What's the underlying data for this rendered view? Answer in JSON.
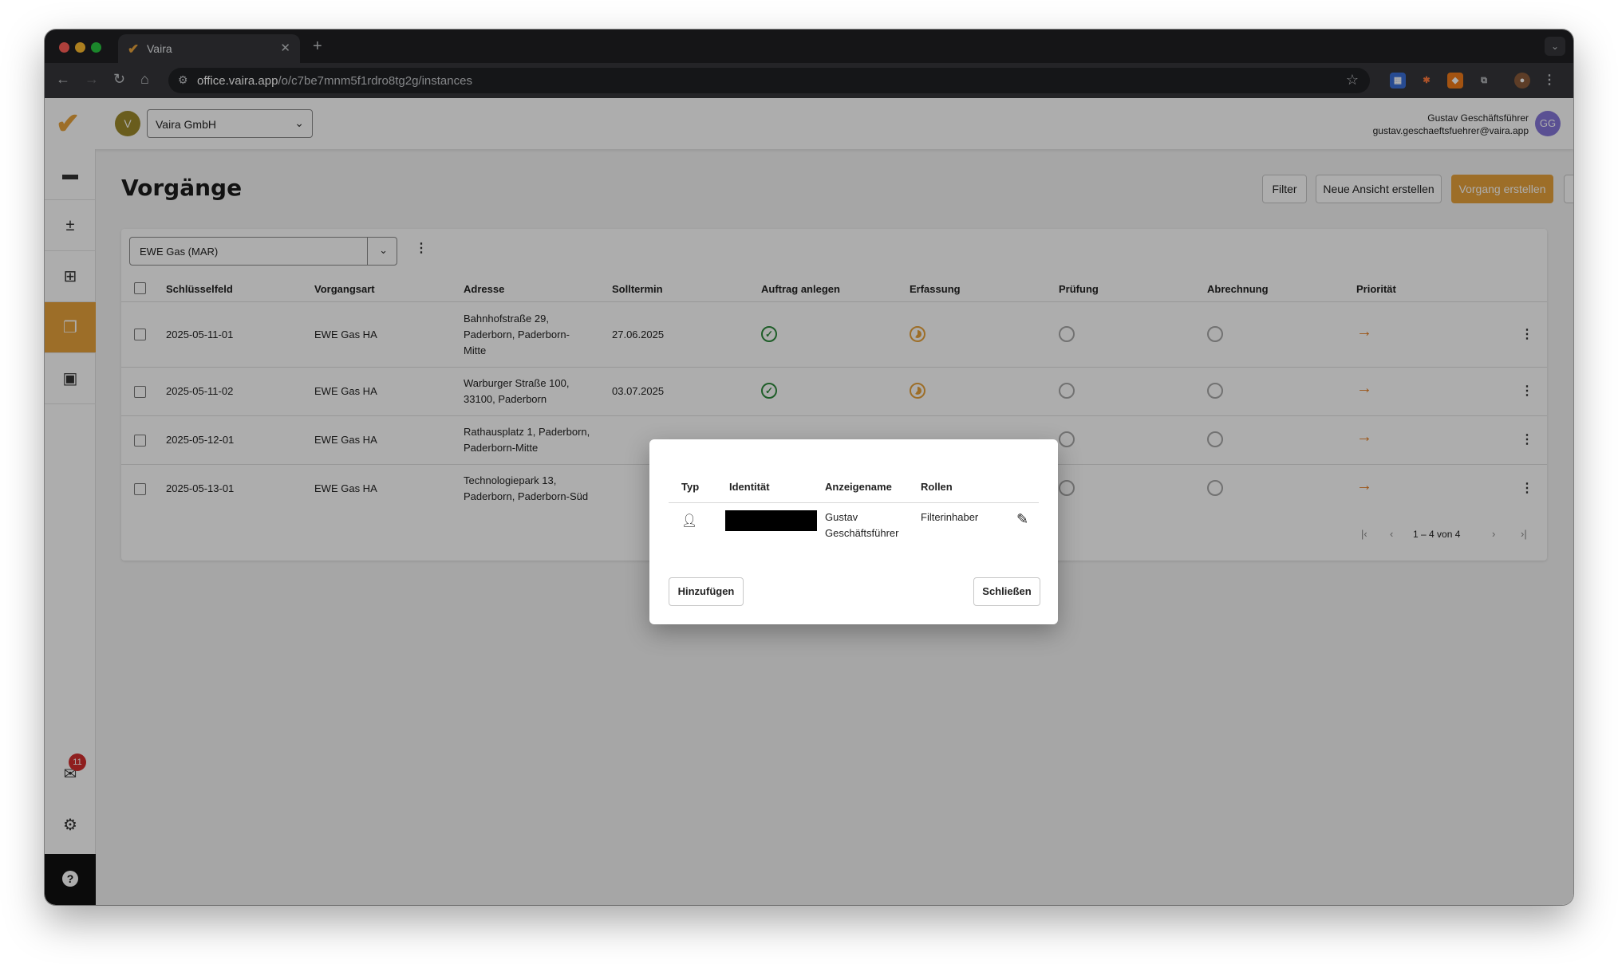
{
  "browser": {
    "tab_title": "Vaira",
    "url_host": "office.vaira.app",
    "url_path": "/o/c7be7mnm5f1rdro8tg2g/instances"
  },
  "header": {
    "org_avatar": "V",
    "org_name": "Vaira GmbH",
    "user_name": "Gustav Geschäftsführer",
    "user_email": "gustav.geschaeftsfuehrer@vaira.app",
    "user_initials": "GG"
  },
  "sidebar": {
    "notification_count": "11",
    "help_symbol": "?"
  },
  "page": {
    "title": "Vorgänge",
    "filter_label": "Filter",
    "new_view_label": "Neue Ansicht erstellen",
    "create_label": "Vorgang erstellen"
  },
  "view_select": {
    "value": "EWE Gas (MAR)"
  },
  "table": {
    "columns": [
      "Schlüsselfeld",
      "Vorgangsart",
      "Adresse",
      "Solltermin",
      "Auftrag anlegen",
      "Erfassung",
      "Prüfung",
      "Abrechnung",
      "Priorität"
    ],
    "rows": [
      {
        "key": "2025-05-11-01",
        "type": "EWE Gas HA",
        "address_lines": [
          "Bahnhofstraße 29,",
          "Paderborn, Paderborn-",
          "Mitte"
        ],
        "date": "27.06.2025",
        "auftrag": "done",
        "erfassung": "in-progress",
        "pruefung": "open",
        "abrechnung": "open",
        "prio": "→"
      },
      {
        "key": "2025-05-11-02",
        "type": "EWE Gas HA",
        "address_lines": [
          "Warburger Straße 100,",
          "33100, Paderborn"
        ],
        "date": "03.07.2025",
        "auftrag": "done",
        "erfassung": "in-progress",
        "pruefung": "open",
        "abrechnung": "open",
        "prio": "→"
      },
      {
        "key": "2025-05-12-01",
        "type": "EWE Gas HA",
        "address_lines": [
          "Rathausplatz 1, Paderborn,",
          "Paderborn-Mitte"
        ],
        "date": "",
        "auftrag": "hidden",
        "erfassung": "hidden",
        "pruefung": "open",
        "abrechnung": "open",
        "prio": "→"
      },
      {
        "key": "2025-05-13-01",
        "type": "EWE Gas HA",
        "address_lines": [
          "Technologiepark 13,",
          "Paderborn, Paderborn-Süd"
        ],
        "date": "",
        "auftrag": "hidden",
        "erfassung": "hidden",
        "pruefung": "open",
        "abrechnung": "open",
        "prio": "→"
      }
    ],
    "pagination": "1 – 4 von 4"
  },
  "dialog": {
    "columns": [
      "Typ",
      "Identität",
      "Anzeigename",
      "Rollen"
    ],
    "entry": {
      "display_name_line1": "Gustav",
      "display_name_line2": "Geschäftsführer",
      "role": "Filterinhaber"
    },
    "add_label": "Hinzufügen",
    "close_label": "Schließen"
  },
  "colors": {
    "accent": "#e8a33b",
    "success": "#2e8b3d",
    "priority": "#e67e22",
    "user_avatar": "#8577d9",
    "org_avatar": "#9c8a2c"
  }
}
